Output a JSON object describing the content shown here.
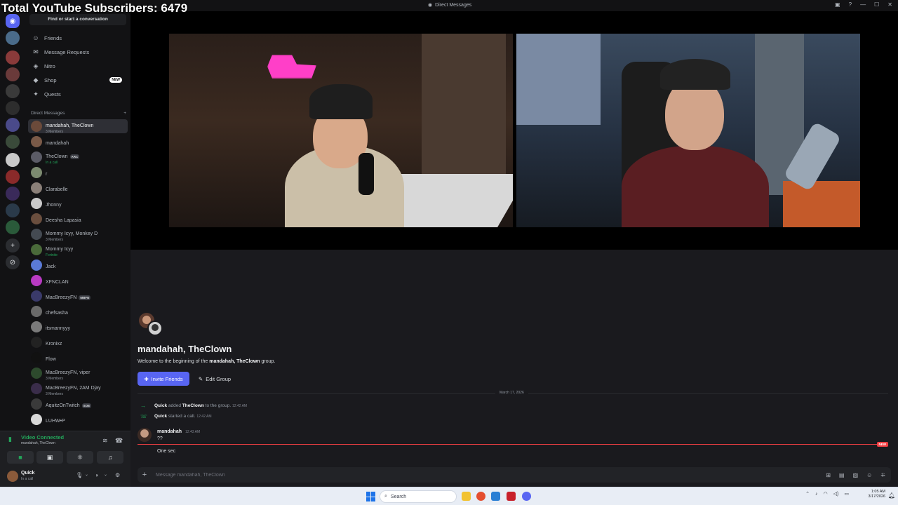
{
  "overlay": {
    "subscriber_text": "Total YouTube Subscribers: 6479"
  },
  "window": {
    "title": "Direct Messages",
    "minimize": "—",
    "maximize": "☐",
    "close": "✕"
  },
  "sidebar": {
    "search_label": "Find or start a conversation",
    "nav": [
      {
        "label": "Friends",
        "icon": "friends-icon"
      },
      {
        "label": "Message Requests",
        "icon": "mail-icon"
      },
      {
        "label": "Nitro",
        "icon": "nitro-icon"
      },
      {
        "label": "Shop",
        "icon": "shop-icon",
        "badge": "NEW"
      },
      {
        "label": "Quests",
        "icon": "quests-icon"
      }
    ],
    "dm_header": "Direct Messages",
    "dm_add": "+",
    "dms": [
      {
        "name": "mandahah, TheClown",
        "sub": "3 Members",
        "color": "#6b4a3a"
      },
      {
        "name": "mandahah",
        "sub": "",
        "color": "#7a5a48"
      },
      {
        "name": "TheClown",
        "sub": "In a call",
        "tag": "ARC",
        "color": "#5b5b66"
      },
      {
        "name": "r",
        "sub": "",
        "color": "#7c8a70"
      },
      {
        "name": "Clarabelle",
        "sub": "",
        "color": "#8a7f78"
      },
      {
        "name": "Jhonny",
        "sub": "",
        "color": "#c9c9c9"
      },
      {
        "name": "Deesha Lapasia",
        "sub": "",
        "color": "#6a4e3e"
      },
      {
        "name": "Mommy Icyy, Monkey D",
        "sub": "3 Members",
        "color": "#444a52"
      },
      {
        "name": "Mommy Icyy",
        "sub": "Fortnite",
        "color": "#4a6a3a"
      },
      {
        "name": "Jack",
        "sub": "",
        "color": "#5a7ad6"
      },
      {
        "name": "XFNCLAN",
        "sub": "",
        "color": "#b83ac2"
      },
      {
        "name": "MacBreezyFN",
        "sub": "",
        "tag": "MBFN",
        "color": "#3a3a6a"
      },
      {
        "name": "chefsasha",
        "sub": "",
        "color": "#6a6a6a"
      },
      {
        "name": "itsmannyyy",
        "sub": "",
        "color": "#7a7a7a"
      },
      {
        "name": "Kronixz",
        "sub": "",
        "color": "#222"
      },
      {
        "name": "Flow",
        "sub": "",
        "color": "#111"
      },
      {
        "name": "MacBreezyFN, viper",
        "sub": "3 Members",
        "color": "#2d4a2d"
      },
      {
        "name": "MacBreezyFN, 2AM Djay",
        "sub": "3 Members",
        "color": "#3a2d4a"
      },
      {
        "name": "AquitzOnTwitch",
        "sub": "",
        "tag": "SOE",
        "color": "#3a3a3a"
      },
      {
        "name": "LUHW•P",
        "sub": "",
        "color": "#d8d8d8"
      }
    ]
  },
  "voice_panel": {
    "status": "Video Connected",
    "channel": "mandahah, TheClown",
    "user_name": "Quick",
    "user_status": "In a call"
  },
  "chat": {
    "title": "mandahah, TheClown",
    "welcome_prefix": "Welcome to the beginning of the",
    "welcome_group": "mandahah, TheClown",
    "welcome_suffix": "group.",
    "invite_label": "Invite Friends",
    "edit_label": "Edit Group",
    "date_divider": "March 17, 2026",
    "system_messages": [
      {
        "actor": "Quick",
        "verb": "added",
        "target": "TheClown",
        "rest": "to the group.",
        "time": "12:42 AM"
      },
      {
        "actor": "Quick",
        "verb": "started a call.",
        "target": "",
        "rest": "",
        "time": "12:42 AM"
      }
    ],
    "message": {
      "author": "mandahah",
      "time": "12:43 AM",
      "lines": [
        "??",
        "One sec"
      ]
    },
    "new_tag": "NEW",
    "composer_placeholder": "Message mandahah, TheClown"
  },
  "taskbar": {
    "search_label": "Search",
    "time": "1:05 AM",
    "date": "3/17/2026"
  },
  "colors": {
    "accent": "#5865f2",
    "online": "#23a55a",
    "new_red": "#f23f43"
  }
}
